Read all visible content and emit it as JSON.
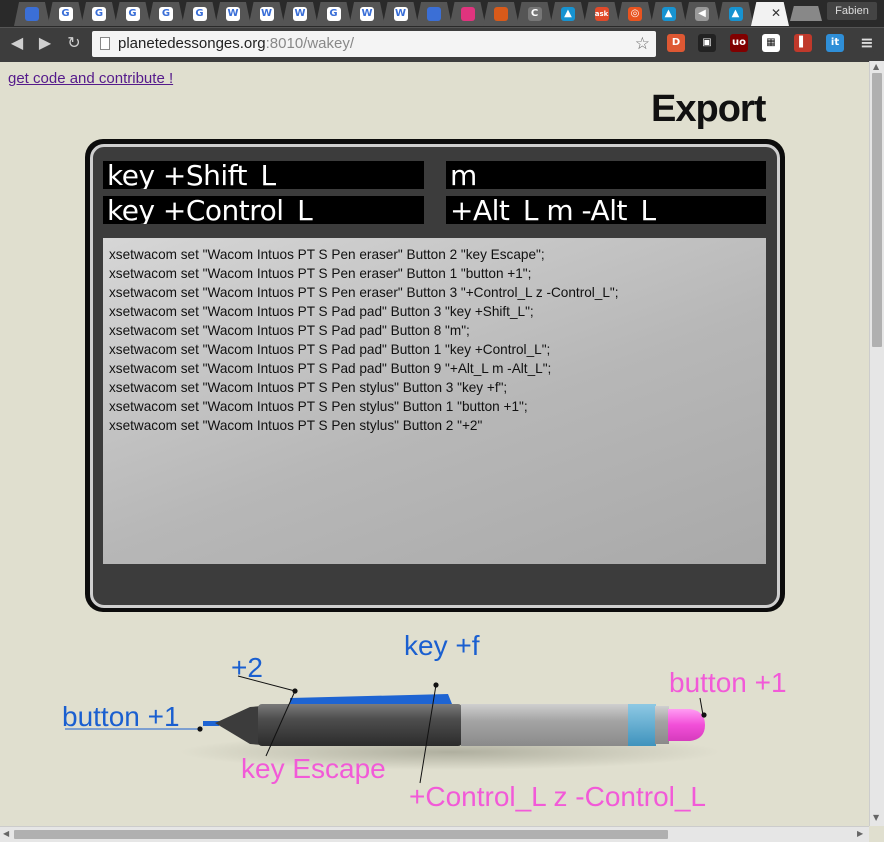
{
  "browser": {
    "tabs": [
      {
        "icon": "feedly-icon",
        "glyph": "",
        "color": "#3b6fd6"
      },
      {
        "icon": "google-icon",
        "glyph": "G",
        "color": "#ffffff"
      },
      {
        "icon": "google-icon",
        "glyph": "G",
        "color": "#ffffff"
      },
      {
        "icon": "google-icon",
        "glyph": "G",
        "color": "#ffffff"
      },
      {
        "icon": "google-icon",
        "glyph": "G",
        "color": "#ffffff"
      },
      {
        "icon": "google-icon",
        "glyph": "G",
        "color": "#ffffff"
      },
      {
        "icon": "wikipedia-icon",
        "glyph": "W",
        "color": "#ffffff"
      },
      {
        "icon": "wikipedia-icon",
        "glyph": "W",
        "color": "#ffffff"
      },
      {
        "icon": "wikipedia-icon",
        "glyph": "W",
        "color": "#ffffff"
      },
      {
        "icon": "google-icon",
        "glyph": "G",
        "color": "#ffffff"
      },
      {
        "icon": "wikipedia-icon",
        "glyph": "W",
        "color": "#ffffff"
      },
      {
        "icon": "wikipedia-icon",
        "glyph": "W",
        "color": "#ffffff"
      },
      {
        "icon": "feedly-icon",
        "glyph": "",
        "color": "#3b6fd6"
      },
      {
        "icon": "pink-app-icon",
        "glyph": "",
        "color": "#e0347e"
      },
      {
        "icon": "firefox-icon",
        "glyph": "",
        "color": "#d85a1a"
      },
      {
        "icon": "c-icon",
        "glyph": "C",
        "color": "#777777"
      },
      {
        "icon": "arch-icon",
        "glyph": "▲",
        "color": "#1793d1"
      },
      {
        "icon": "ask-icon",
        "glyph": "ask",
        "color": "#e14a2a"
      },
      {
        "icon": "ubuntu-icon",
        "glyph": "◎",
        "color": "#e95420"
      },
      {
        "icon": "arch-icon",
        "glyph": "▲",
        "color": "#1793d1"
      },
      {
        "icon": "speaker-icon",
        "glyph": "◀",
        "color": "#999999"
      },
      {
        "icon": "arch-icon",
        "glyph": "▲",
        "color": "#1793d1"
      }
    ],
    "active_close": "✕",
    "profile_name": "Fabien",
    "nav": {
      "back": "◀",
      "forward": "▶",
      "reload": "↻"
    },
    "url_host": "planetedessonges.org",
    "url_rest": ":8010/wakey/",
    "star": "☆",
    "extensions": [
      {
        "icon": "duckduckgo-icon",
        "glyph": "D",
        "color": "#de5833"
      },
      {
        "icon": "pocket-icon",
        "glyph": "▣",
        "color": "#222222"
      },
      {
        "icon": "ublock-icon",
        "glyph": "uo",
        "color": "#800000"
      },
      {
        "icon": "qr-code-icon",
        "glyph": "▦",
        "color": "#ffffff"
      },
      {
        "icon": "bookmark-book-icon",
        "glyph": "▌",
        "color": "#c0392b"
      },
      {
        "icon": "it-icon",
        "glyph": "it",
        "color": "#2f8fd8"
      },
      {
        "icon": "menu-icon",
        "glyph": "≡",
        "color": "#3d3d3d"
      }
    ]
  },
  "page": {
    "contribute_link": "get code and contribute !",
    "export_title": "Export"
  },
  "keys": {
    "pad_button_3": "key +Shift_L",
    "pad_button_8": "m",
    "pad_button_1": "key +Control_L",
    "pad_button_9": "+Alt_L m -Alt_L"
  },
  "code_lines": [
    "xsetwacom set \"Wacom Intuos PT S Pen eraser\" Button 2 \"key Escape\";",
    "xsetwacom set \"Wacom Intuos PT S Pen eraser\" Button 1 \"button +1\";",
    "xsetwacom set \"Wacom Intuos PT S Pen eraser\" Button 3 \"+Control_L z -Control_L\";",
    "xsetwacom set \"Wacom Intuos PT S Pad pad\" Button 3 \"key +Shift_L\";",
    "xsetwacom set \"Wacom Intuos PT S Pad pad\" Button 8 \"m\";",
    "xsetwacom set \"Wacom Intuos PT S Pad pad\" Button 1 \"key +Control_L\";",
    "xsetwacom set \"Wacom Intuos PT S Pad pad\" Button 9 \"+Alt_L m -Alt_L\";",
    "xsetwacom set \"Wacom Intuos PT S Pen stylus\" Button 3 \"key +f\";",
    "xsetwacom set \"Wacom Intuos PT S Pen stylus\" Button 1 \"button +1\";",
    "xsetwacom set \"Wacom Intuos PT S Pen stylus\" Button 2 \"+2\""
  ],
  "pen_labels": {
    "stylus_button_3": "key +f",
    "stylus_button_2": "+2",
    "stylus_button_1": "button +1",
    "eraser_button_2": "key Escape",
    "eraser_button_3": "+Control_L z -Control_L",
    "eraser_button_1": "button +1"
  },
  "colors": {
    "stylus_label": "#1a5fd0",
    "eraser_label": "#f25ad8",
    "visited_link": "#551a8b"
  }
}
